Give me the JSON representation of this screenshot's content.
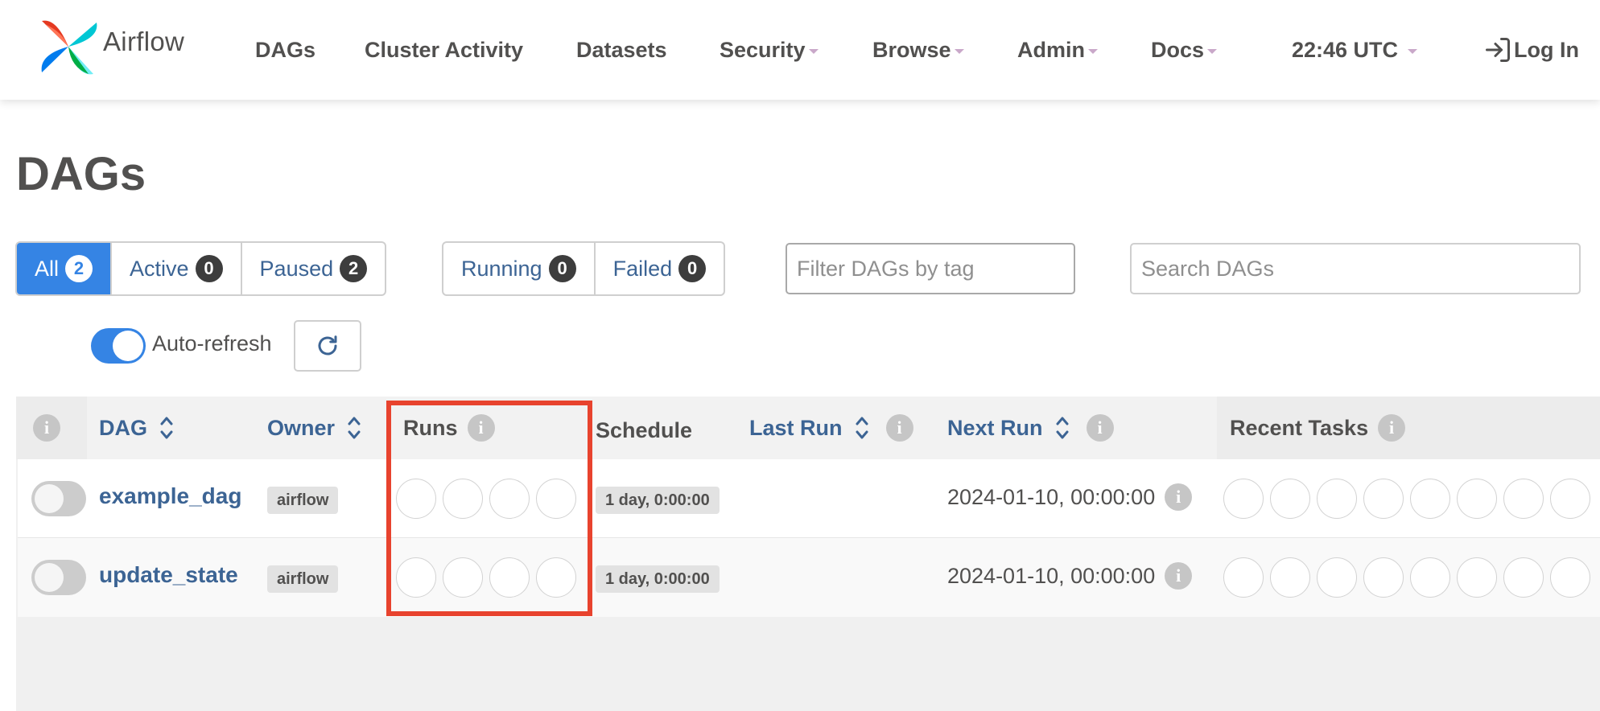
{
  "brand": {
    "name": "Airflow"
  },
  "nav": {
    "dags": "DAGs",
    "cluster_activity": "Cluster Activity",
    "datasets": "Datasets",
    "security": "Security",
    "browse": "Browse",
    "admin": "Admin",
    "docs": "Docs",
    "time": "22:46 UTC",
    "login": "Log In"
  },
  "page_title": "DAGs",
  "filters": {
    "all": {
      "label": "All",
      "count": "2"
    },
    "active": {
      "label": "Active",
      "count": "0"
    },
    "paused": {
      "label": "Paused",
      "count": "2"
    },
    "running": {
      "label": "Running",
      "count": "0"
    },
    "failed": {
      "label": "Failed",
      "count": "0"
    },
    "tag_placeholder": "Filter DAGs by tag",
    "search_placeholder": "Search DAGs"
  },
  "auto_refresh": {
    "label": "Auto-refresh",
    "enabled": true
  },
  "table": {
    "headers": {
      "dag": "DAG",
      "owner": "Owner",
      "runs": "Runs",
      "schedule": "Schedule",
      "last_run": "Last Run",
      "next_run": "Next Run",
      "recent_tasks": "Recent Tasks"
    },
    "rows": [
      {
        "dag_id": "example_dag",
        "owner": "airflow",
        "schedule": "1 day, 0:00:00",
        "last_run": "",
        "next_run": "2024-01-10, 00:00:00",
        "paused": true
      },
      {
        "dag_id": "update_state",
        "owner": "airflow",
        "schedule": "1 day, 0:00:00",
        "last_run": "",
        "next_run": "2024-01-10, 00:00:00",
        "paused": true
      }
    ]
  },
  "colors": {
    "accent": "#3584e4",
    "link": "#3c6494",
    "highlight": "#e8432e"
  },
  "icons": [
    "pinwheel-logo-icon",
    "login-icon",
    "refresh-icon",
    "info-icon",
    "sort-icon"
  ]
}
